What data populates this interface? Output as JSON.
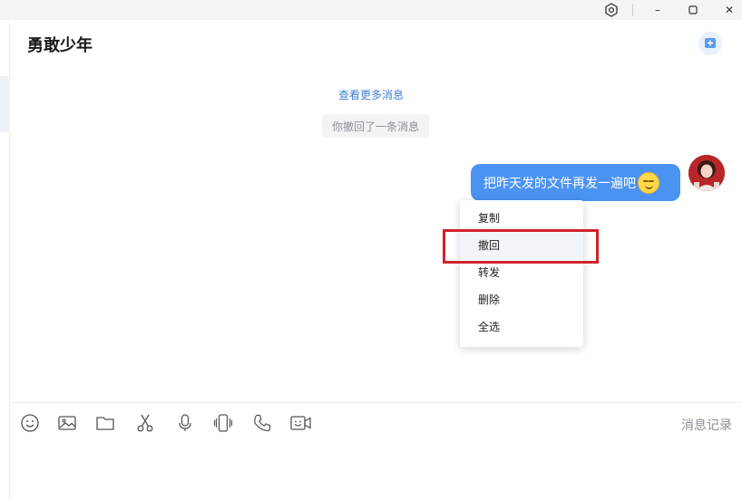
{
  "window": {
    "controls": {
      "minimize": "–",
      "maximize": "☐",
      "close": "✕"
    }
  },
  "chat": {
    "title": "勇敢少年"
  },
  "messages": {
    "load_more": "查看更多消息",
    "recall_notice": "你撤回了一条消息",
    "outgoing": {
      "text": "把昨天发的文件再发一遍吧",
      "emoji": "smile-emoji"
    }
  },
  "context_menu": {
    "items": [
      {
        "label": "复制"
      },
      {
        "label": "撤回"
      },
      {
        "label": "转发"
      },
      {
        "label": "删除"
      },
      {
        "label": "全选"
      }
    ],
    "highlighted_index": 1
  },
  "toolbar": {
    "icons": [
      "emoji-icon",
      "image-icon",
      "folder-icon",
      "scissors-icon",
      "microphone-icon",
      "shake-icon",
      "phone-icon",
      "video-call-icon"
    ],
    "history_label": "消息记录"
  },
  "colors": {
    "bubble": "#4b93f2",
    "link": "#3d7fd6",
    "highlight_border": "#d0222e"
  }
}
